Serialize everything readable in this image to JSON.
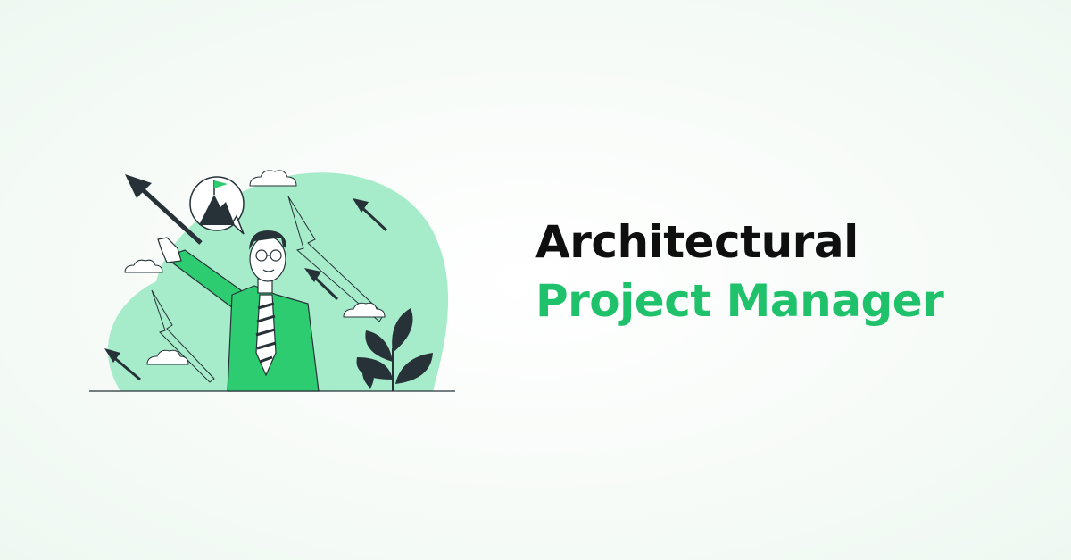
{
  "headline": {
    "line1": "Architectural",
    "line2": "Project Manager"
  },
  "colors": {
    "accent": "#1fc16b",
    "text": "#0f0f0f",
    "blob": "#a6eccb",
    "shirt": "#2ecc71",
    "dark": "#263238"
  },
  "illustration": {
    "icons": [
      "mountain-flag-icon",
      "arrow-icon",
      "cloud-icon",
      "plant-icon"
    ]
  }
}
